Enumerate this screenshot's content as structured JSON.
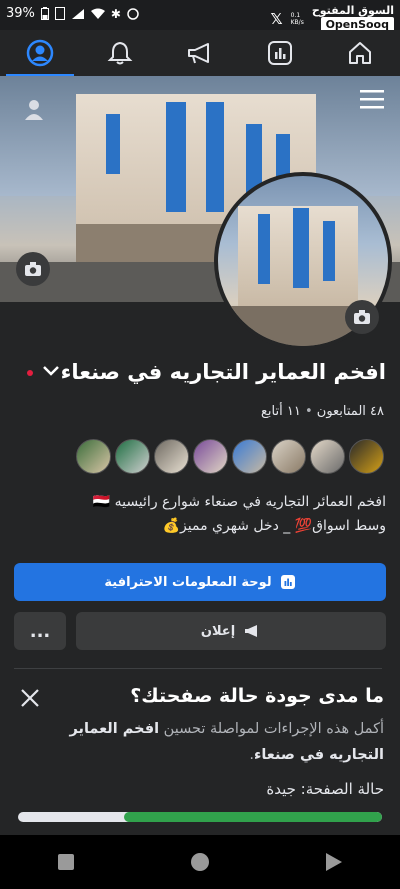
{
  "status_bar": {
    "battery": "39%",
    "network_label_1": "0.1",
    "network_label_2": "KB/s",
    "watermark_arabic": "السوق المفتوح",
    "watermark_latin": "OpenSooq"
  },
  "nav": {
    "tabs": [
      {
        "name": "profile",
        "icon": "profile-icon",
        "active": true
      },
      {
        "name": "notifications",
        "icon": "bell-icon",
        "active": false
      },
      {
        "name": "ads",
        "icon": "megaphone-icon",
        "active": false
      },
      {
        "name": "insights",
        "icon": "chart-icon",
        "active": false
      },
      {
        "name": "home",
        "icon": "home-icon",
        "active": false
      }
    ]
  },
  "page": {
    "name": "افخم العماير التجاريه في صنعاء",
    "followers_label": "٤٨ المتابعون",
    "separator": "•",
    "following_label": "١١ أتابع",
    "about_line1": "افخم العمائر التجاريه في صنعاء شوارع رائيسيه 🇾🇪",
    "about_line2": "وسط اسواق💯 _ دخل شهري مميز💰",
    "dashboard_button": "لوحة المعلومات الاحترافية",
    "ad_button": "إعلان",
    "more_button": "..."
  },
  "quality": {
    "title": "ما مدى جودة حالة صفحتك؟",
    "desc_prefix": "أكمل هذه الإجراءات لمواصلة تحسين",
    "desc_bold": "افخم العماير التجاريه في صنعاء",
    "desc_suffix": ".",
    "status_line": "حالة الصفحة: جيدة",
    "progress": 0.71
  },
  "colors": {
    "accent": "#2374e1",
    "progress_good": "#31a24c",
    "background": "#242526"
  }
}
